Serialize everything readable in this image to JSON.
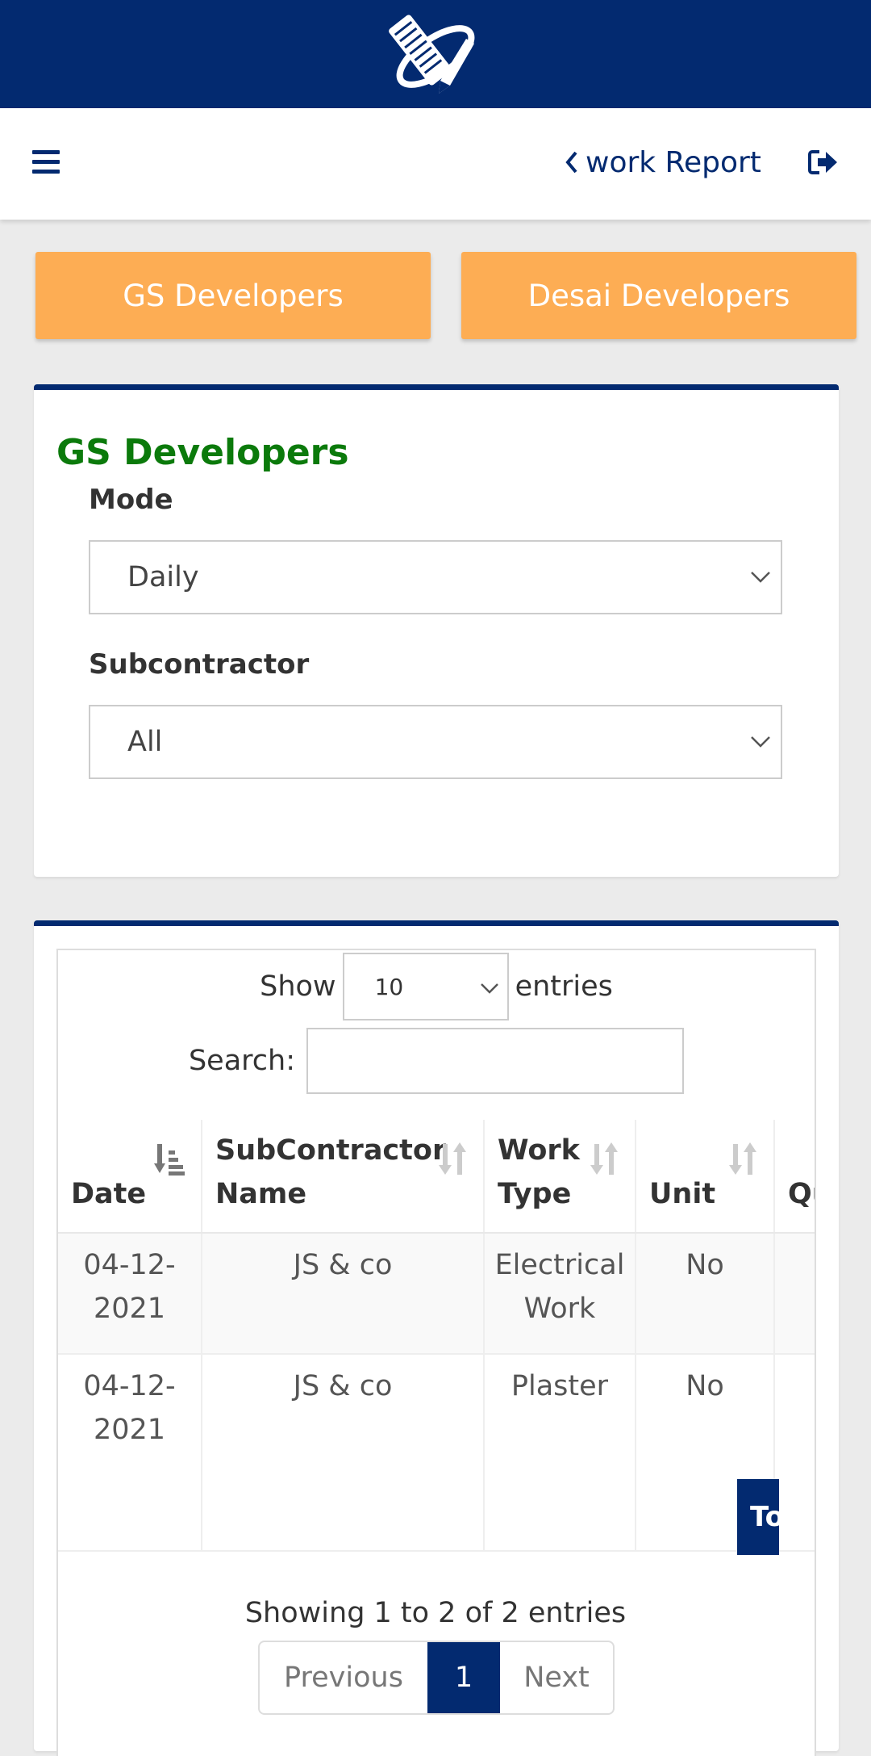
{
  "header": {
    "page_title": "work Report"
  },
  "projects": [
    {
      "label": "GS Developers"
    },
    {
      "label": "Desai Developers"
    }
  ],
  "filters": {
    "title": "GS Developers",
    "mode_label": "Mode",
    "mode_value": "Daily",
    "sub_label": "Subcontractor",
    "sub_value": "All"
  },
  "datatable": {
    "show_label": "Show",
    "length_value": "10",
    "entries_label": "entries",
    "search_label": "Search:",
    "search_value": "",
    "columns": [
      {
        "line1": "",
        "line2": "Date"
      },
      {
        "line1": "SubContractor",
        "line2": "Name"
      },
      {
        "line1": "Work",
        "line2": "Type"
      },
      {
        "line1": "",
        "line2": "Unit"
      },
      {
        "line1": "",
        "line2": "Qu"
      }
    ],
    "rows": [
      {
        "date1": "04-12-",
        "date2": "2021",
        "sub": "JS & co",
        "work1": "Electrical",
        "work2": "Work",
        "unit": "No",
        "qty": ""
      },
      {
        "date1": "04-12-",
        "date2": "2021",
        "sub": "JS & co",
        "work1": "Plaster",
        "work2": "",
        "unit": "No",
        "qty": ""
      }
    ],
    "total_button": "To",
    "info": "Showing 1 to 2 of 2 entries",
    "pagination": {
      "previous": "Previous",
      "current": "1",
      "next": "Next"
    }
  },
  "colors": {
    "brand_navy": "#032a70",
    "accent_orange": "#fdad54",
    "title_green": "#0b7a0b"
  },
  "icons": [
    "app-logo-icon",
    "hamburger-menu-icon",
    "chevron-left-icon",
    "logout-icon",
    "chevron-down-icon",
    "sort-icon"
  ]
}
